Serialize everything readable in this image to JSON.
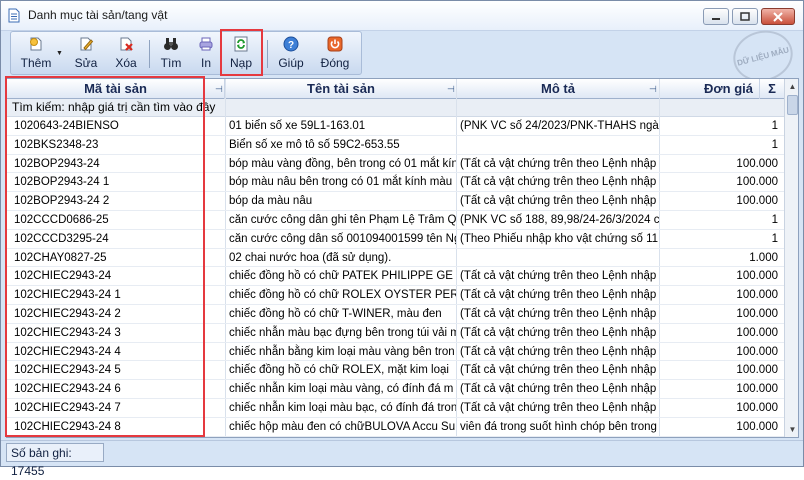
{
  "window": {
    "title": "Danh mục tài sản/tang vật"
  },
  "toolbar": {
    "buttons": [
      {
        "label": "Thêm",
        "icon": "add-doc-icon"
      },
      {
        "label": "Sửa",
        "icon": "edit-icon"
      },
      {
        "label": "Xóa",
        "icon": "delete-icon"
      },
      {
        "label": "Tìm",
        "icon": "binoculars-icon"
      },
      {
        "label": "In",
        "icon": "print-icon"
      },
      {
        "label": "Nạp",
        "icon": "refresh-icon"
      },
      {
        "label": "Giúp",
        "icon": "help-icon"
      },
      {
        "label": "Đóng",
        "icon": "power-icon"
      }
    ]
  },
  "stamp": {
    "text": "DỮ LIỆU MẪU"
  },
  "grid": {
    "columns": [
      "Mã tài sản",
      "Tên tài sản",
      "Mô tả",
      "Đơn giá",
      "Σ"
    ],
    "search_hint": "Tìm kiếm: nhập giá trị cần tìm vào đây",
    "rows": [
      {
        "code": "1020643-24BIENSO",
        "name": "01 biển số xe 59L1-163.01",
        "desc": "(PNK VC số 24/2023/PNK-THAHS  ngà",
        "price": "1"
      },
      {
        "code": "102BKS2348-23",
        "name": "Biển số xe mô tô số 59C2-653.55",
        "desc": "",
        "price": "1"
      },
      {
        "code": "102BOP2943-24",
        "name": "bóp màu vàng đồng, bên trong có 01 mắt kín",
        "desc": "(Tất cả vật chứng trên theo Lệnh nhập",
        "price": "100.000"
      },
      {
        "code": "102BOP2943-24 1",
        "name": "bóp màu nâu bên trong có 01 mắt kính màu",
        "desc": "(Tất cả vật chứng trên theo Lệnh nhập",
        "price": "100.000"
      },
      {
        "code": "102BOP2943-24 2",
        "name": "bóp da màu nâu",
        "desc": "(Tất cả vật chứng trên theo Lệnh nhập",
        "price": "100.000"
      },
      {
        "code": "102CCCD0686-25",
        "name": "căn cước công dân ghi tên Phạm Lệ Trâm Q",
        "desc": "(PNK VC số 188, 89,98/24-26/3/2024 c",
        "price": "1"
      },
      {
        "code": "102CCCD3295-24",
        "name": "căn cước công dân số 001094001599 tên Ng",
        "desc": "(Theo Phiếu nhập kho vật chứng số 11",
        "price": "1"
      },
      {
        "code": "102CHAY0827-25",
        "name": "02 chai nước hoa (đã sử dụng).",
        "desc": "",
        "price": "1.000"
      },
      {
        "code": "102CHIEC2943-24",
        "name": "chiếc đồng hồ có chữ PATEK PHILIPPE GE",
        "desc": "(Tất cả vật chứng trên theo Lệnh nhập",
        "price": "100.000"
      },
      {
        "code": "102CHIEC2943-24 1",
        "name": "chiếc đồng hồ có chữ ROLEX OYSTER PER",
        "desc": "(Tất cả vật chứng trên theo Lệnh nhập",
        "price": "100.000"
      },
      {
        "code": "102CHIEC2943-24 2",
        "name": "chiếc đồng hồ có chữ T-WINER, màu đen",
        "desc": "(Tất cả vật chứng trên theo Lệnh nhập",
        "price": "100.000"
      },
      {
        "code": "102CHIEC2943-24 3",
        "name": "chiếc nhẫn màu bạc đựng bên trong túi vải m",
        "desc": "(Tất cả vật chứng trên theo Lệnh nhập",
        "price": "100.000"
      },
      {
        "code": "102CHIEC2943-24 4",
        "name": "chiếc nhẫn bằng kim loại màu vàng bên tron",
        "desc": "(Tất cả vật chứng trên theo Lệnh nhập",
        "price": "100.000"
      },
      {
        "code": "102CHIEC2943-24 5",
        "name": "chiếc đồng hồ có chữ ROLEX, mặt kim loại",
        "desc": "(Tất cả vật chứng trên theo Lệnh nhập",
        "price": "100.000"
      },
      {
        "code": "102CHIEC2943-24 6",
        "name": "chiếc nhẫn kim loại màu vàng, có đính đá m",
        "desc": "(Tất cả vật chứng trên theo Lệnh nhập",
        "price": "100.000"
      },
      {
        "code": "102CHIEC2943-24 7",
        "name": "chiếc nhẫn kim loại màu bạc, có đính đá tron",
        "desc": "(Tất cả vật chứng trên theo Lệnh nhập",
        "price": "100.000"
      },
      {
        "code": "102CHIEC2943-24 8",
        "name": "chiếc hộp màu đen có chữBULOVA Accu Su",
        "desc": "viên đá trong suốt hình chóp bên trong t",
        "price": "100.000"
      }
    ]
  },
  "status": {
    "record_count": "Số bản ghi: 17455"
  },
  "colors": {
    "highlight": "#e5393f",
    "header_text": "#1a2a55",
    "window_bg": "#d6e4f5"
  }
}
